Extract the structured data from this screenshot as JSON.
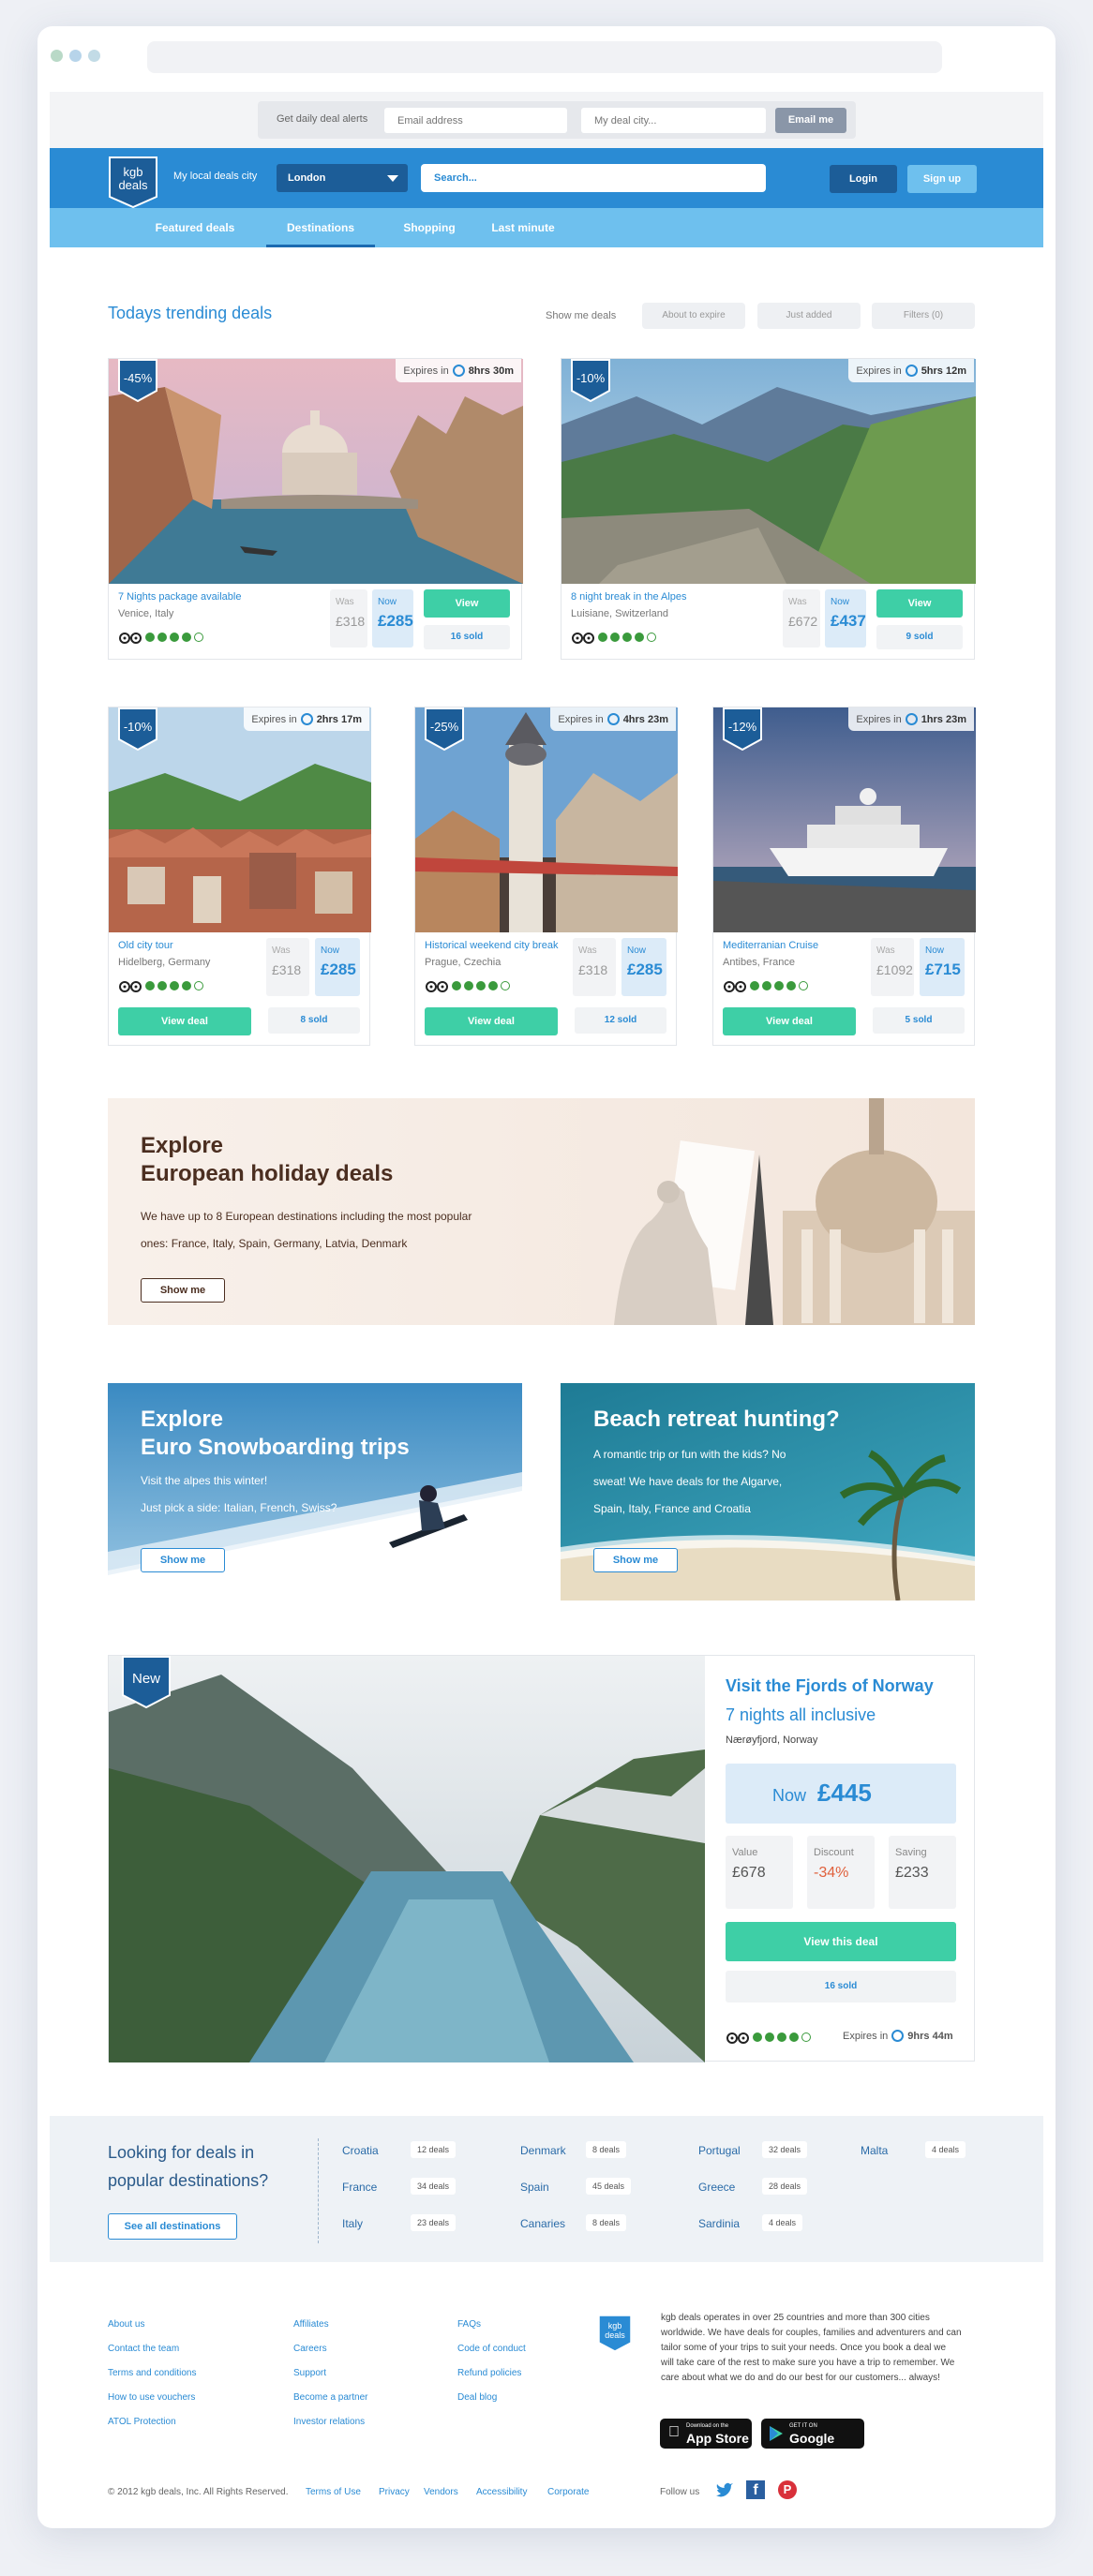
{
  "alerts": {
    "label": "Get daily deal alerts",
    "email_placeholder": "Email address",
    "city_placeholder": "My deal city...",
    "button": "Email me"
  },
  "header": {
    "logo_line1": "kgb",
    "logo_line2": "deals",
    "city_label": "My local deals city",
    "city_value": "London",
    "search_placeholder": "Search...",
    "login": "Login",
    "signup": "Sign up"
  },
  "nav": [
    "Featured deals",
    "Destinations",
    "Shopping",
    "Last minute"
  ],
  "trending": {
    "title": "Todays trending deals",
    "show_label": "Show me deals",
    "filters": [
      "About to expire",
      "Just added",
      "Filters (0)"
    ]
  },
  "deals": [
    {
      "discount": "-45%",
      "expires_label": "Expires in",
      "expires": "8hrs 30m",
      "title": "7 Nights package available",
      "location": "Venice, Italy",
      "was_label": "Was",
      "was": "£318",
      "now_label": "Now",
      "now": "£285",
      "button": "View",
      "sold": "16 sold",
      "rating": 5
    },
    {
      "discount": "-10%",
      "expires_label": "Expires in",
      "expires": "5hrs 12m",
      "title": "8 night break in the Alpes",
      "location": "Luisiane, Switzerland",
      "was_label": "Was",
      "was": "£672",
      "now_label": "Now",
      "now": "£437",
      "button": "View",
      "sold": "9 sold",
      "rating": 4
    },
    {
      "discount": "-10%",
      "expires_label": "Expires in",
      "expires": "2hrs 17m",
      "title": "Old city tour",
      "location": "Hidelberg, Germany",
      "was_label": "Was",
      "was": "£318",
      "now_label": "Now",
      "now": "£285",
      "button": "View deal",
      "sold": "8 sold",
      "rating": 4
    },
    {
      "discount": "-25%",
      "expires_label": "Expires in",
      "expires": "4hrs 23m",
      "title": "Historical weekend city break",
      "location": "Prague, Czechia",
      "was_label": "Was",
      "was": "£318",
      "now_label": "Now",
      "now": "£285",
      "button": "View deal",
      "sold": "12 sold",
      "rating": 4
    },
    {
      "discount": "-12%",
      "expires_label": "Expires in",
      "expires": "1hrs 23m",
      "title": "Mediterranian Cruise",
      "location": "Antibes, France",
      "was_label": "Was",
      "was": "£1092",
      "now_label": "Now",
      "now": "£715",
      "button": "View deal",
      "sold": "5 sold",
      "rating": 4
    }
  ],
  "europe_banner": {
    "title_line1": "Explore",
    "title_line2": "European holiday deals",
    "text_line1": "We have up to 8 European destinations including the most popular",
    "text_line2": "ones: France, Italy, Spain, Germany, Latvia, Denmark",
    "button": "Show me"
  },
  "snow_banner": {
    "title_line1": "Explore",
    "title_line2": "Euro Snowboarding trips",
    "text_line1": "Visit the alpes this winter!",
    "text_line2": "Just pick a side: Italian, French, Swiss?",
    "button": "Show me"
  },
  "beach_banner": {
    "title": "Beach retreat hunting?",
    "text_line1": "A romantic trip or fun with the kids? No",
    "text_line2": "sweat! We have deals for the Algarve,",
    "text_line3": "Spain, Italy, France and Croatia",
    "button": "Show me"
  },
  "norway": {
    "badge": "New",
    "title": "Visit the Fjords of Norway",
    "subtitle": "7 nights all inclusive",
    "location": "Nærøyfjord, Norway",
    "now_label": "Now",
    "now": "£445",
    "value_label": "Value",
    "value": "£678",
    "discount_label": "Discount",
    "discount": "-34%",
    "saving_label": "Saving",
    "saving": "£233",
    "button": "View this deal",
    "sold": "16 sold",
    "expires_label": "Expires in",
    "expires": "9hrs 44m",
    "rating": 4
  },
  "popular": {
    "title_line1": "Looking for deals in",
    "title_line2": "popular destinations?",
    "button": "See all destinations",
    "destinations": [
      {
        "name": "Croatia",
        "count": "12 deals"
      },
      {
        "name": "Denmark",
        "count": "8 deals"
      },
      {
        "name": "Portugal",
        "count": "32 deals"
      },
      {
        "name": "Malta",
        "count": "4 deals"
      },
      {
        "name": "France",
        "count": "34 deals"
      },
      {
        "name": "Spain",
        "count": "45 deals"
      },
      {
        "name": "Greece",
        "count": "28 deals"
      },
      {
        "name": "Italy",
        "count": "23 deals"
      },
      {
        "name": "Canaries",
        "count": "8 deals"
      },
      {
        "name": "Sardinia",
        "count": "4 deals"
      }
    ]
  },
  "footer": {
    "col1": [
      "About us",
      "Contact the team",
      "Terms and conditions",
      "How to use vouchers",
      "ATOL Protection"
    ],
    "col2": [
      "Affiliates",
      "Careers",
      "Support",
      "Become a partner",
      "Investor relations"
    ],
    "col3": [
      "FAQs",
      "Code of conduct",
      "Refund policies",
      "Deal blog"
    ],
    "about_lines": [
      "kgb deals operates in over 25 countries and more than 300 cities",
      "worldwide. We have deals for couples, families and adventurers and can",
      "tailor some of your trips to suit your needs. Once you book a deal we",
      "will take care of the rest to make sure you have a trip to remember. We",
      "care about what we do and do our best for our customers... always!"
    ],
    "appstore_small": "Download on the",
    "appstore": "App Store",
    "googleplay_small": "GET IT ON",
    "googleplay": "Google Play",
    "copyright": "© 2012 kgb deals, Inc. All Rights Reserved.",
    "bottom_links": [
      "Terms of Use",
      "Privacy",
      "Vendors",
      "Accessibility",
      "Corporate"
    ],
    "follow": "Follow us"
  },
  "colors": {
    "primary": "#2a8bd4",
    "nav": "#6ec0ee",
    "green": "#3ecfa6",
    "dark_blue": "#1c5d98"
  }
}
